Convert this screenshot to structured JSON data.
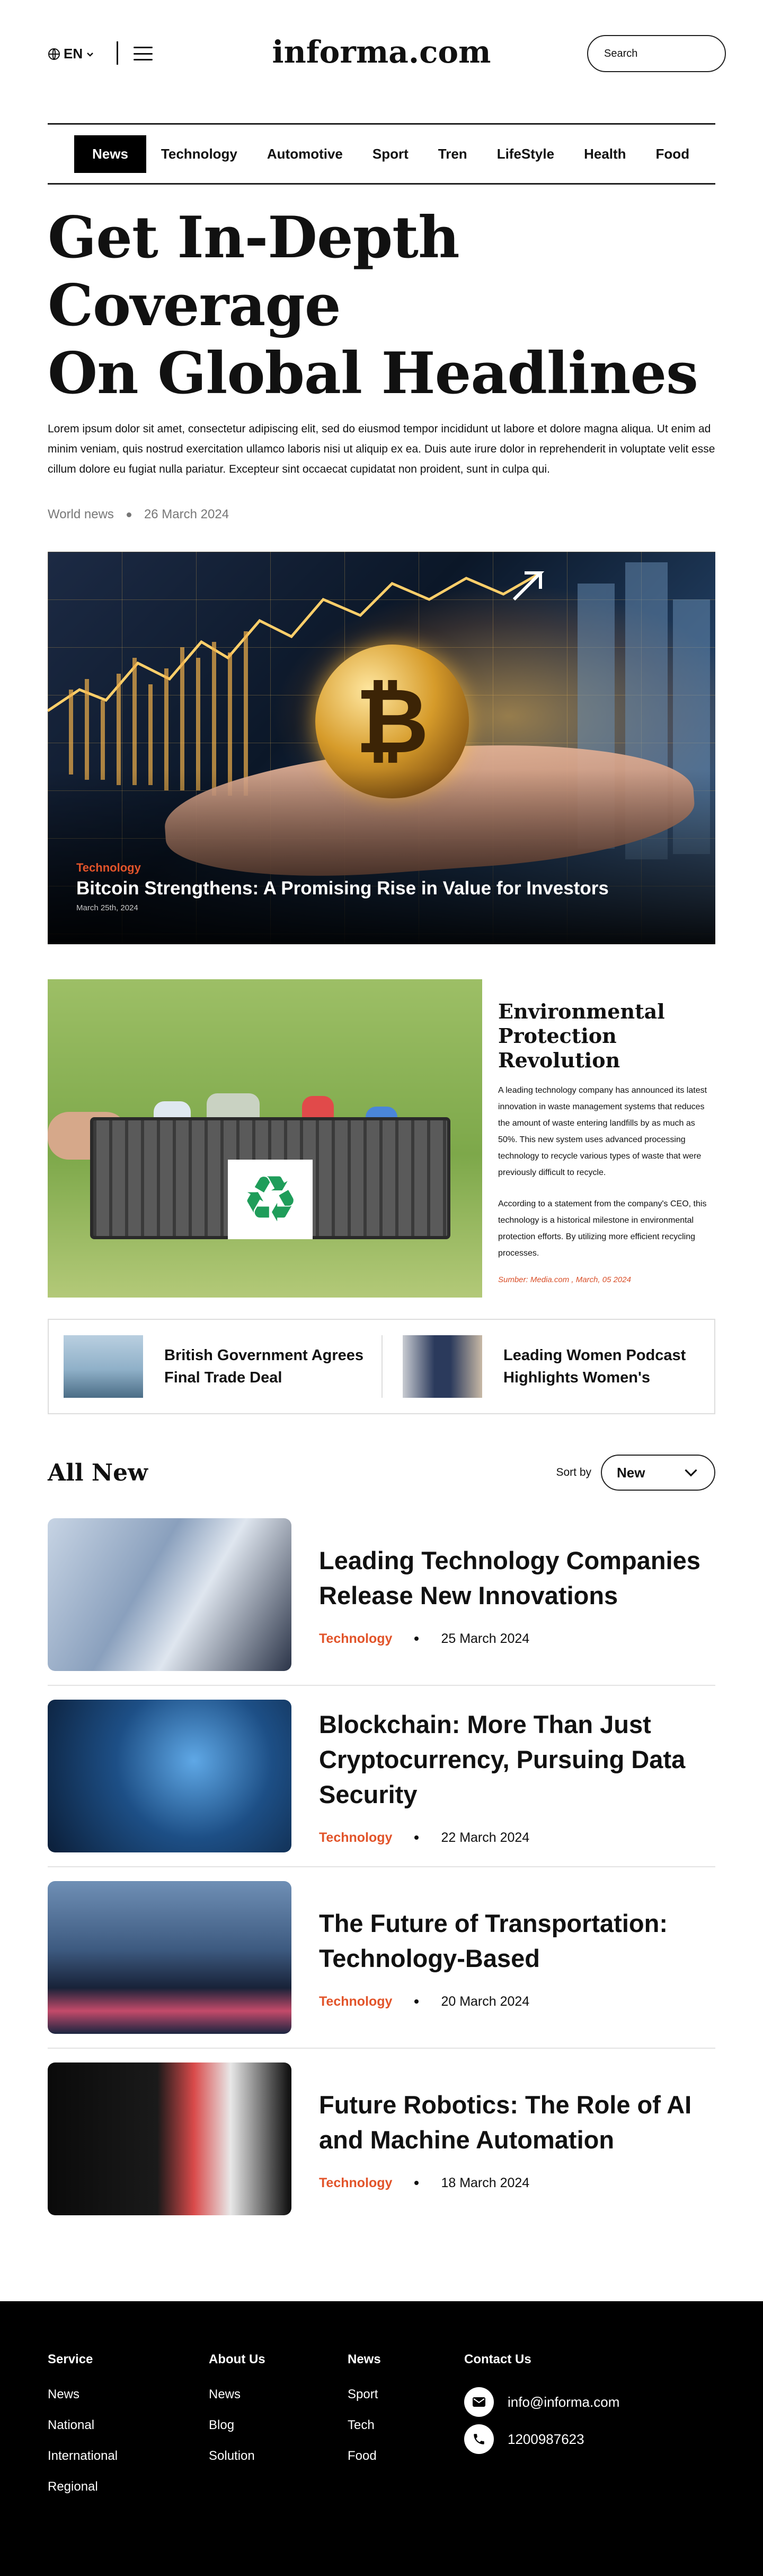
{
  "header": {
    "lang": "EN",
    "logo": "informa.com",
    "search_placeholder": "Search"
  },
  "nav": {
    "items": [
      "News",
      "Technology",
      "Automotive",
      "Sport",
      "Tren",
      "LifeStyle",
      "Health",
      "Food"
    ],
    "active": "News"
  },
  "hero": {
    "title_line1": "Get In-Depth Coverage",
    "title_line2": "On Global Headlines",
    "lead": "Lorem ipsum dolor sit amet, consectetur adipiscing elit, sed do eiusmod tempor incididunt ut labore et dolore magna aliqua. Ut enim ad minim veniam, quis nostrud exercitation ullamco laboris nisi ut aliquip ex ea. Duis aute irure dolor in reprehenderit in voluptate velit esse cillum dolore eu fugiat nulla pariatur. Excepteur sint occaecat cupidatat non proident, sunt in culpa qui.",
    "category": "World news",
    "date": "26 March 2024"
  },
  "featured": {
    "category": "Technology",
    "title": "Bitcoin Strengthens: A Promising Rise in Value for Investors",
    "date": "March 25th, 2024",
    "coin_symbol": "₿"
  },
  "environment": {
    "title": "Environmental Protection Revolution",
    "para1": "A leading technology company has announced its latest innovation in waste management systems that reduces the amount of waste entering landfills by as much as 50%. This new system uses advanced processing technology to recycle various types of waste that were previously difficult to recycle.",
    "para2": "According to a statement from the company's CEO, this technology is a historical milestone in environmental protection efforts. By utilizing more efficient recycling processes.",
    "source": "Sumber: Media.com , March, 05 2024",
    "recycle_symbol": "♻"
  },
  "minis": [
    {
      "title": "British Government Agrees Final Trade Deal"
    },
    {
      "title": "Leading Women Podcast Highlights Women's"
    }
  ],
  "all_new": {
    "heading": "All New",
    "sort_label": "Sort by",
    "sort_value": "New",
    "articles": [
      {
        "title": "Leading Technology Companies Release New Innovations",
        "category": "Technology",
        "date": "25 March 2024"
      },
      {
        "title": "Blockchain: More Than Just Cryptocurrency, Pursuing Data Security",
        "category": "Technology",
        "date": "22 March 2024"
      },
      {
        "title": "The Future of Transportation: Technology-Based",
        "category": "Technology",
        "date": "20 March 2024"
      },
      {
        "title": "Future Robotics: The Role of AI and Machine Automation",
        "category": "Technology",
        "date": "18 March 2024"
      }
    ]
  },
  "footer": {
    "service": {
      "heading": "Service",
      "links": [
        "News",
        "National",
        "International",
        "Regional"
      ]
    },
    "about": {
      "heading": "About Us",
      "links": [
        "News",
        "Blog",
        "Solution"
      ]
    },
    "news": {
      "heading": "News",
      "links": [
        "Sport",
        "Tech",
        "Food"
      ]
    },
    "contact": {
      "heading": "Contact Us",
      "email": "info@informa.com",
      "phone": "1200987623"
    }
  },
  "colors": {
    "accent": "#e2542a",
    "text": "#111111",
    "footer_bg": "#000000"
  }
}
